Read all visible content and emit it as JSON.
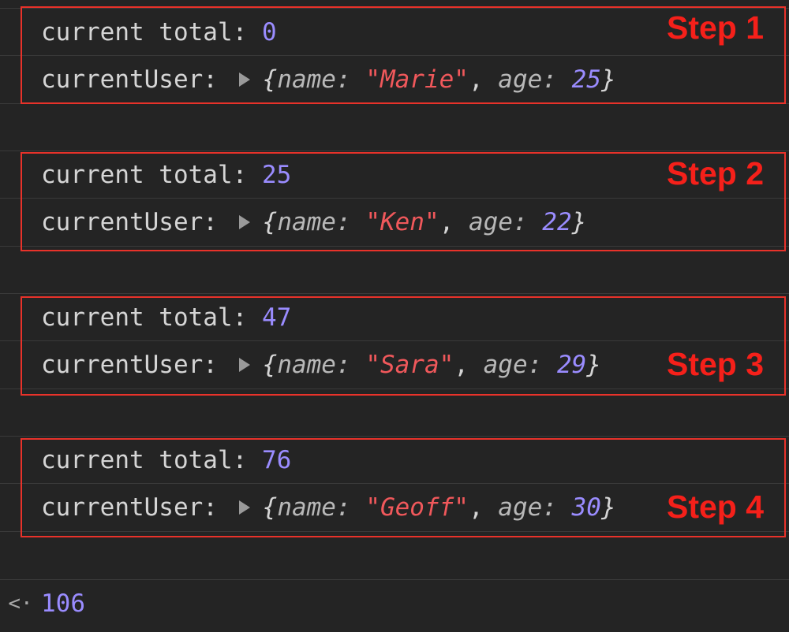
{
  "steps": [
    {
      "label": "Step 1",
      "total_label": "current total:",
      "total": "0",
      "user_label": "currentUser:",
      "name_key": "name:",
      "name": "\"Marie\"",
      "age_key": "age:",
      "age": "25"
    },
    {
      "label": "Step 2",
      "total_label": "current total:",
      "total": "25",
      "user_label": "currentUser:",
      "name_key": "name:",
      "name": "\"Ken\"",
      "age_key": "age:",
      "age": "22"
    },
    {
      "label": "Step 3",
      "total_label": "current total:",
      "total": "47",
      "user_label": "currentUser:",
      "name_key": "name:",
      "name": "\"Sara\"",
      "age_key": "age:",
      "age": "29"
    },
    {
      "label": "Step 4",
      "total_label": "current total:",
      "total": "76",
      "user_label": "currentUser:",
      "name_key": "name:",
      "name": "\"Geoff\"",
      "age_key": "age:",
      "age": "30"
    }
  ],
  "result": {
    "arrow": "<·",
    "value": "106"
  },
  "colors": {
    "annotation": "#f5201a",
    "number": "#9a8cff",
    "string": "#f0585b",
    "background": "#242424"
  }
}
